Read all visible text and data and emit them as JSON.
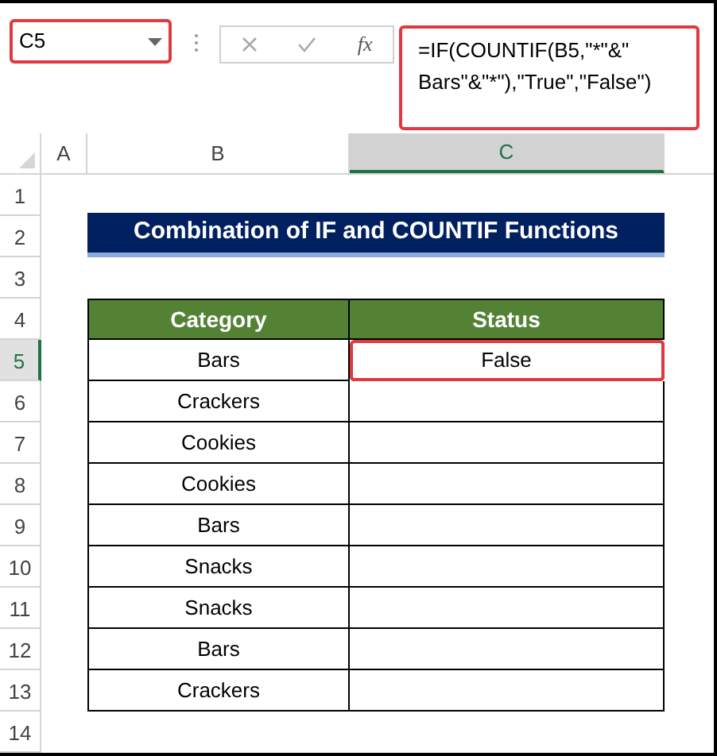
{
  "name_box": {
    "value": "C5"
  },
  "formula_bar": {
    "fx_label": "fx",
    "formula": "=IF(COUNTIF(B5,\"*\"&\" Bars\"&\"*\"),\"True\",\"False\")"
  },
  "columns": [
    {
      "label": "A",
      "selected": false
    },
    {
      "label": "B",
      "selected": false
    },
    {
      "label": "C",
      "selected": true
    }
  ],
  "rows": [
    {
      "number": "1",
      "selected": false
    },
    {
      "number": "2",
      "selected": false
    },
    {
      "number": "3",
      "selected": false
    },
    {
      "number": "4",
      "selected": false
    },
    {
      "number": "5",
      "selected": true
    },
    {
      "number": "6",
      "selected": false
    },
    {
      "number": "7",
      "selected": false
    },
    {
      "number": "8",
      "selected": false
    },
    {
      "number": "9",
      "selected": false
    },
    {
      "number": "10",
      "selected": false
    },
    {
      "number": "11",
      "selected": false
    },
    {
      "number": "12",
      "selected": false
    },
    {
      "number": "13",
      "selected": false
    },
    {
      "number": "14",
      "selected": false
    }
  ],
  "title": "Combination of IF and COUNTIF Functions",
  "table": {
    "columns": [
      "Category",
      "Status"
    ],
    "rows": [
      {
        "category": "Bars",
        "status": "False",
        "selected": true
      },
      {
        "category": "Crackers",
        "selected": false
      },
      {
        "category": "Cookies",
        "selected": false
      },
      {
        "category": "Cookies",
        "selected": false
      },
      {
        "category": "Bars",
        "selected": false
      },
      {
        "category": "Snacks",
        "selected": false
      },
      {
        "category": "Snacks",
        "selected": false
      },
      {
        "category": "Bars",
        "selected": false
      },
      {
        "category": "Crackers",
        "selected": false
      }
    ]
  }
}
